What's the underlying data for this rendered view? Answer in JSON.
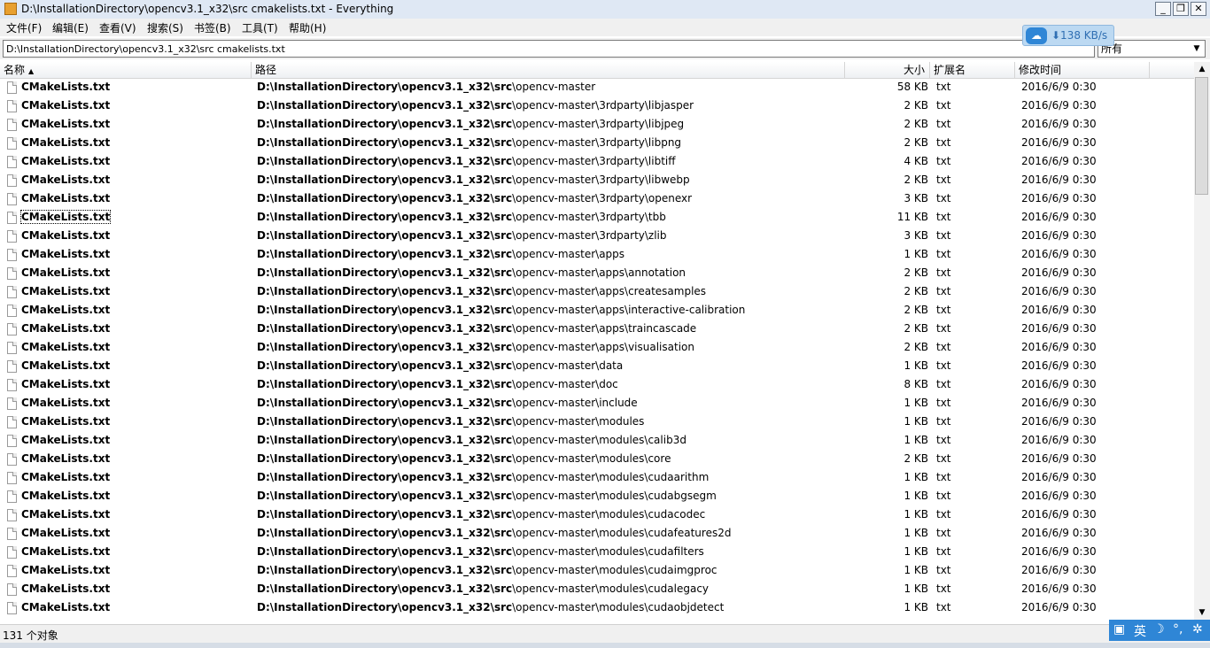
{
  "window": {
    "title": "D:\\InstallationDirectory\\opencv3.1_x32\\src cmakelists.txt - Everything",
    "min_label": "_",
    "max_label": "❐",
    "close_label": "✕"
  },
  "menu": [
    {
      "label": "文件(F)"
    },
    {
      "label": "编辑(E)"
    },
    {
      "label": "查看(V)"
    },
    {
      "label": "搜索(S)"
    },
    {
      "label": "书签(B)"
    },
    {
      "label": "工具(T)"
    },
    {
      "label": "帮助(H)"
    }
  ],
  "search": {
    "value": "D:\\InstallationDirectory\\opencv3.1_x32\\src cmakelists.txt",
    "filter_selected": "所有"
  },
  "speed_widget": {
    "text": "⬇138 KB/s"
  },
  "columns": {
    "name": "名称",
    "path": "路径",
    "size": "大小",
    "ext": "扩展名",
    "mtime": "修改时间"
  },
  "rows": [
    {
      "name": "CMakeLists.txt",
      "path_bold": "D:\\InstallationDirectory\\opencv3.1_x32\\src",
      "path_rest": "\\opencv-master",
      "size": "58 KB",
      "ext": "txt",
      "mtime": "2016/6/9 0:30"
    },
    {
      "name": "CMakeLists.txt",
      "path_bold": "D:\\InstallationDirectory\\opencv3.1_x32\\src",
      "path_rest": "\\opencv-master\\3rdparty\\libjasper",
      "size": "2 KB",
      "ext": "txt",
      "mtime": "2016/6/9 0:30"
    },
    {
      "name": "CMakeLists.txt",
      "path_bold": "D:\\InstallationDirectory\\opencv3.1_x32\\src",
      "path_rest": "\\opencv-master\\3rdparty\\libjpeg",
      "size": "2 KB",
      "ext": "txt",
      "mtime": "2016/6/9 0:30"
    },
    {
      "name": "CMakeLists.txt",
      "path_bold": "D:\\InstallationDirectory\\opencv3.1_x32\\src",
      "path_rest": "\\opencv-master\\3rdparty\\libpng",
      "size": "2 KB",
      "ext": "txt",
      "mtime": "2016/6/9 0:30"
    },
    {
      "name": "CMakeLists.txt",
      "path_bold": "D:\\InstallationDirectory\\opencv3.1_x32\\src",
      "path_rest": "\\opencv-master\\3rdparty\\libtiff",
      "size": "4 KB",
      "ext": "txt",
      "mtime": "2016/6/9 0:30"
    },
    {
      "name": "CMakeLists.txt",
      "path_bold": "D:\\InstallationDirectory\\opencv3.1_x32\\src",
      "path_rest": "\\opencv-master\\3rdparty\\libwebp",
      "size": "2 KB",
      "ext": "txt",
      "mtime": "2016/6/9 0:30"
    },
    {
      "name": "CMakeLists.txt",
      "path_bold": "D:\\InstallationDirectory\\opencv3.1_x32\\src",
      "path_rest": "\\opencv-master\\3rdparty\\openexr",
      "size": "3 KB",
      "ext": "txt",
      "mtime": "2016/6/9 0:30"
    },
    {
      "name": "CMakeLists.txt",
      "path_bold": "D:\\InstallationDirectory\\opencv3.1_x32\\src",
      "path_rest": "\\opencv-master\\3rdparty\\tbb",
      "size": "11 KB",
      "ext": "txt",
      "mtime": "2016/6/9 0:30",
      "focused": true
    },
    {
      "name": "CMakeLists.txt",
      "path_bold": "D:\\InstallationDirectory\\opencv3.1_x32\\src",
      "path_rest": "\\opencv-master\\3rdparty\\zlib",
      "size": "3 KB",
      "ext": "txt",
      "mtime": "2016/6/9 0:30"
    },
    {
      "name": "CMakeLists.txt",
      "path_bold": "D:\\InstallationDirectory\\opencv3.1_x32\\src",
      "path_rest": "\\opencv-master\\apps",
      "size": "1 KB",
      "ext": "txt",
      "mtime": "2016/6/9 0:30"
    },
    {
      "name": "CMakeLists.txt",
      "path_bold": "D:\\InstallationDirectory\\opencv3.1_x32\\src",
      "path_rest": "\\opencv-master\\apps\\annotation",
      "size": "2 KB",
      "ext": "txt",
      "mtime": "2016/6/9 0:30"
    },
    {
      "name": "CMakeLists.txt",
      "path_bold": "D:\\InstallationDirectory\\opencv3.1_x32\\src",
      "path_rest": "\\opencv-master\\apps\\createsamples",
      "size": "2 KB",
      "ext": "txt",
      "mtime": "2016/6/9 0:30"
    },
    {
      "name": "CMakeLists.txt",
      "path_bold": "D:\\InstallationDirectory\\opencv3.1_x32\\src",
      "path_rest": "\\opencv-master\\apps\\interactive-calibration",
      "size": "2 KB",
      "ext": "txt",
      "mtime": "2016/6/9 0:30"
    },
    {
      "name": "CMakeLists.txt",
      "path_bold": "D:\\InstallationDirectory\\opencv3.1_x32\\src",
      "path_rest": "\\opencv-master\\apps\\traincascade",
      "size": "2 KB",
      "ext": "txt",
      "mtime": "2016/6/9 0:30"
    },
    {
      "name": "CMakeLists.txt",
      "path_bold": "D:\\InstallationDirectory\\opencv3.1_x32\\src",
      "path_rest": "\\opencv-master\\apps\\visualisation",
      "size": "2 KB",
      "ext": "txt",
      "mtime": "2016/6/9 0:30"
    },
    {
      "name": "CMakeLists.txt",
      "path_bold": "D:\\InstallationDirectory\\opencv3.1_x32\\src",
      "path_rest": "\\opencv-master\\data",
      "size": "1 KB",
      "ext": "txt",
      "mtime": "2016/6/9 0:30"
    },
    {
      "name": "CMakeLists.txt",
      "path_bold": "D:\\InstallationDirectory\\opencv3.1_x32\\src",
      "path_rest": "\\opencv-master\\doc",
      "size": "8 KB",
      "ext": "txt",
      "mtime": "2016/6/9 0:30"
    },
    {
      "name": "CMakeLists.txt",
      "path_bold": "D:\\InstallationDirectory\\opencv3.1_x32\\src",
      "path_rest": "\\opencv-master\\include",
      "size": "1 KB",
      "ext": "txt",
      "mtime": "2016/6/9 0:30"
    },
    {
      "name": "CMakeLists.txt",
      "path_bold": "D:\\InstallationDirectory\\opencv3.1_x32\\src",
      "path_rest": "\\opencv-master\\modules",
      "size": "1 KB",
      "ext": "txt",
      "mtime": "2016/6/9 0:30"
    },
    {
      "name": "CMakeLists.txt",
      "path_bold": "D:\\InstallationDirectory\\opencv3.1_x32\\src",
      "path_rest": "\\opencv-master\\modules\\calib3d",
      "size": "1 KB",
      "ext": "txt",
      "mtime": "2016/6/9 0:30"
    },
    {
      "name": "CMakeLists.txt",
      "path_bold": "D:\\InstallationDirectory\\opencv3.1_x32\\src",
      "path_rest": "\\opencv-master\\modules\\core",
      "size": "2 KB",
      "ext": "txt",
      "mtime": "2016/6/9 0:30"
    },
    {
      "name": "CMakeLists.txt",
      "path_bold": "D:\\InstallationDirectory\\opencv3.1_x32\\src",
      "path_rest": "\\opencv-master\\modules\\cudaarithm",
      "size": "1 KB",
      "ext": "txt",
      "mtime": "2016/6/9 0:30"
    },
    {
      "name": "CMakeLists.txt",
      "path_bold": "D:\\InstallationDirectory\\opencv3.1_x32\\src",
      "path_rest": "\\opencv-master\\modules\\cudabgsegm",
      "size": "1 KB",
      "ext": "txt",
      "mtime": "2016/6/9 0:30"
    },
    {
      "name": "CMakeLists.txt",
      "path_bold": "D:\\InstallationDirectory\\opencv3.1_x32\\src",
      "path_rest": "\\opencv-master\\modules\\cudacodec",
      "size": "1 KB",
      "ext": "txt",
      "mtime": "2016/6/9 0:30"
    },
    {
      "name": "CMakeLists.txt",
      "path_bold": "D:\\InstallationDirectory\\opencv3.1_x32\\src",
      "path_rest": "\\opencv-master\\modules\\cudafeatures2d",
      "size": "1 KB",
      "ext": "txt",
      "mtime": "2016/6/9 0:30"
    },
    {
      "name": "CMakeLists.txt",
      "path_bold": "D:\\InstallationDirectory\\opencv3.1_x32\\src",
      "path_rest": "\\opencv-master\\modules\\cudafilters",
      "size": "1 KB",
      "ext": "txt",
      "mtime": "2016/6/9 0:30"
    },
    {
      "name": "CMakeLists.txt",
      "path_bold": "D:\\InstallationDirectory\\opencv3.1_x32\\src",
      "path_rest": "\\opencv-master\\modules\\cudaimgproc",
      "size": "1 KB",
      "ext": "txt",
      "mtime": "2016/6/9 0:30"
    },
    {
      "name": "CMakeLists.txt",
      "path_bold": "D:\\InstallationDirectory\\opencv3.1_x32\\src",
      "path_rest": "\\opencv-master\\modules\\cudalegacy",
      "size": "1 KB",
      "ext": "txt",
      "mtime": "2016/6/9 0:30"
    },
    {
      "name": "CMakeLists.txt",
      "path_bold": "D:\\InstallationDirectory\\opencv3.1_x32\\src",
      "path_rest": "\\opencv-master\\modules\\cudaobjdetect",
      "size": "1 KB",
      "ext": "txt",
      "mtime": "2016/6/9 0:30"
    }
  ],
  "status": {
    "count": "131 个对象"
  },
  "ime": {
    "lang": "英",
    "moon": "☽",
    "punct": "°,",
    "gear": "✲"
  },
  "colors": {
    "accent": "#2f86d6"
  }
}
